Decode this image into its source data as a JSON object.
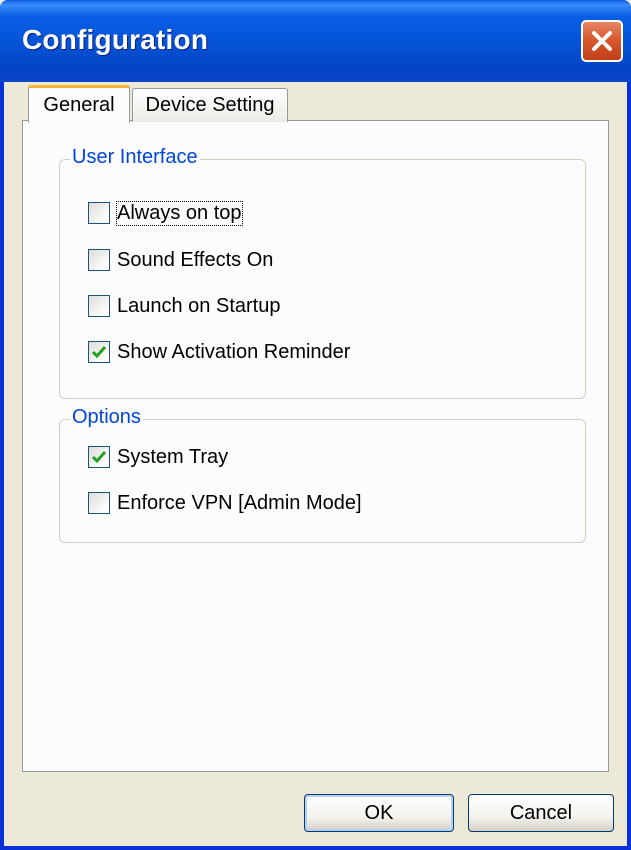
{
  "window": {
    "title": "Configuration"
  },
  "tabs": [
    {
      "label": "General",
      "selected": true
    },
    {
      "label": "Device Setting",
      "selected": false
    }
  ],
  "user_interface": {
    "legend": "User Interface",
    "options": [
      {
        "label": "Always on top",
        "checked": false,
        "focused": true
      },
      {
        "label": "Sound Effects On",
        "checked": false
      },
      {
        "label": "Launch on Startup",
        "checked": false
      },
      {
        "label": "Show Activation Reminder",
        "checked": true
      }
    ]
  },
  "options_group": {
    "legend": "Options",
    "options": [
      {
        "label": "System Tray",
        "checked": true
      },
      {
        "label": "Enforce VPN [Admin Mode]",
        "checked": false
      }
    ]
  },
  "buttons": {
    "ok": "OK",
    "cancel": "Cancel"
  },
  "colors": {
    "titlebar": "#0552d6",
    "group_legend": "#0046d5",
    "checkmark": "#21a121",
    "close": "#d75a2c"
  }
}
